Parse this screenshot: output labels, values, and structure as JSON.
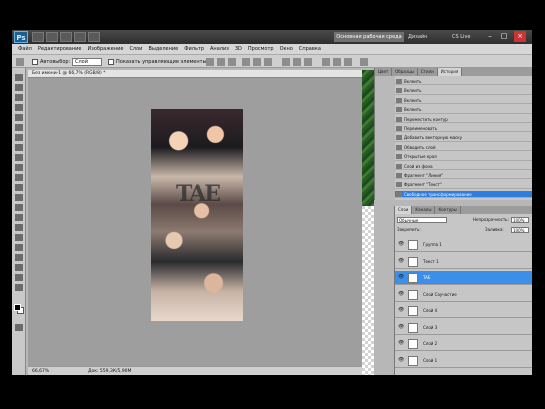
{
  "titlebar": {
    "logo": "Ps",
    "workspace_button": "Основная рабочая среда",
    "design_label": "Дизайн",
    "cslive_label": "CS Live",
    "minimize": "–",
    "maximize": "□",
    "close": "×"
  },
  "menu": [
    "Файл",
    "Редактирование",
    "Изображение",
    "Слои",
    "Выделение",
    "Фильтр",
    "Анализ",
    "3D",
    "Просмотр",
    "Окно",
    "Справка"
  ],
  "options": {
    "autoselect_label": "Автовыбор:",
    "autoselect_value": "Слой",
    "transform_label": "Показать управляющие элементы"
  },
  "document": {
    "tab_title": "Без имени-1 @ 66,7% (RGB/8) *",
    "zoom": "66,67%",
    "doc_size": "Док: 559,3К/5,90М",
    "artwork_text": "TAE"
  },
  "history": {
    "tabs": [
      "Цвет",
      "Образцы",
      "Стили",
      "История"
    ],
    "active_tab": "История",
    "items": [
      "Вклеить",
      "Вклеить",
      "Вклеить",
      "Вклеить",
      "Переместить контур",
      "Переименовать",
      "Добавить векторную маску",
      "Обводить слой",
      "Открытые края",
      "Слой из фона",
      "Фрагмент \"Линия\"",
      "Фрагмент \"Текст\"",
      "Свободное трансформирование"
    ],
    "selected_index": 12
  },
  "layers": {
    "tabs": [
      "Слои",
      "Каналы",
      "Контуры"
    ],
    "blend_mode": "Обычные",
    "opacity_label": "Непрозрачность:",
    "opacity_value": "100%",
    "lock_label": "Закрепить:",
    "fill_label": "Заливка:",
    "fill_value": "100%",
    "items": [
      {
        "name": "Группа 1",
        "type": "folder"
      },
      {
        "name": "Текст 1",
        "type": "text"
      },
      {
        "name": "TAE",
        "type": "text"
      },
      {
        "name": "Слой Соучастие",
        "type": "image"
      },
      {
        "name": "Слой 4",
        "type": "layer"
      },
      {
        "name": "Слой 3",
        "type": "layer"
      },
      {
        "name": "Слой 2",
        "type": "layer"
      },
      {
        "name": "Слой 1",
        "type": "layer"
      }
    ],
    "selected_index": 2
  }
}
